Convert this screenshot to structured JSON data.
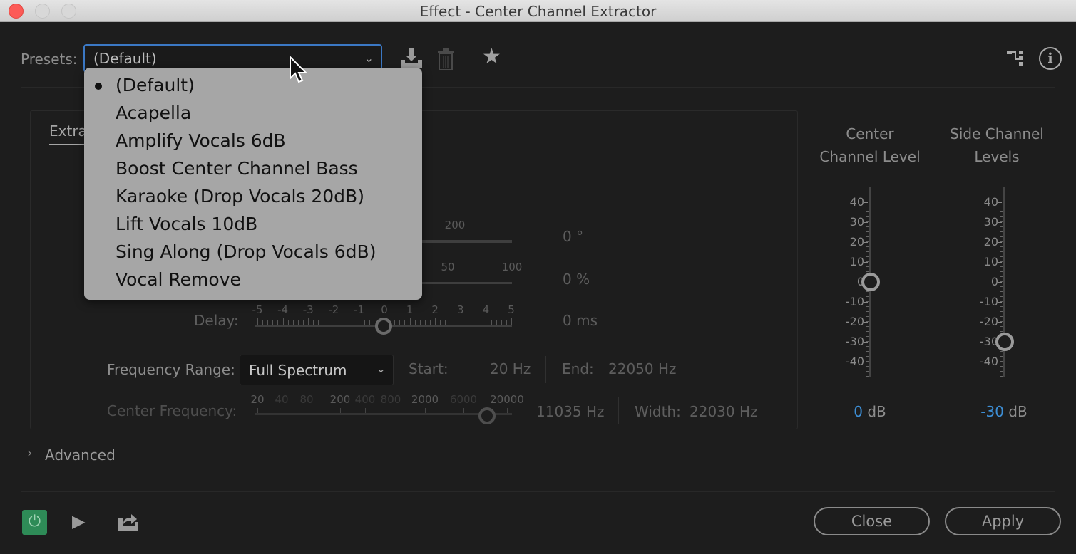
{
  "window": {
    "title": "Effect - Center Channel Extractor"
  },
  "presets": {
    "label": "Presets:",
    "value": "(Default)",
    "menu": [
      "(Default)",
      "Acapella",
      "Amplify Vocals 6dB",
      "Boost Center Channel Bass",
      "Karaoke (Drop Vocals 20dB)",
      "Lift Vocals 10dB",
      "Sing Along (Drop Vocals 6dB)",
      "Vocal Remove"
    ],
    "selected_index": 0
  },
  "tab": {
    "label": "Extraction"
  },
  "phase": {
    "tick_label": "200",
    "value": "0 °"
  },
  "pan": {
    "tick_labels": [
      "50",
      "100"
    ],
    "value": "0 %"
  },
  "delay": {
    "label": "Delay:",
    "ticks": [
      "-5",
      "-4",
      "-3",
      "-2",
      "-1",
      "0",
      "1",
      "2",
      "3",
      "4",
      "5"
    ],
    "value": "0 ms",
    "level": 0
  },
  "frequency_range": {
    "label": "Frequency Range:",
    "value": "Full Spectrum",
    "start_label": "Start:",
    "start_value": "20 Hz",
    "end_label": "End:",
    "end_value": "22050 Hz"
  },
  "center_frequency": {
    "label": "Center Frequency:",
    "ticks": [
      "20",
      "40",
      "80",
      "200",
      "400",
      "800",
      "2000",
      "6000",
      "20000"
    ],
    "value": "11035 Hz",
    "width_label": "Width:",
    "width_value": "22030 Hz"
  },
  "meters": {
    "ticks": [
      "40",
      "30",
      "20",
      "10",
      "0",
      "-10",
      "-20",
      "-30",
      "-40"
    ],
    "center": {
      "title1": "Center",
      "title2": "Channel Level",
      "value": "0",
      "unit": "dB",
      "level_db": 0
    },
    "side": {
      "title1": "Side Channel",
      "title2": "Levels",
      "value": "-30",
      "unit": "dB",
      "level_db": -30
    },
    "value_color": "#3d8fd6"
  },
  "advanced": {
    "label": "Advanced"
  },
  "footer": {
    "close": "Close",
    "apply": "Apply",
    "power_color": "#2e8b57"
  }
}
